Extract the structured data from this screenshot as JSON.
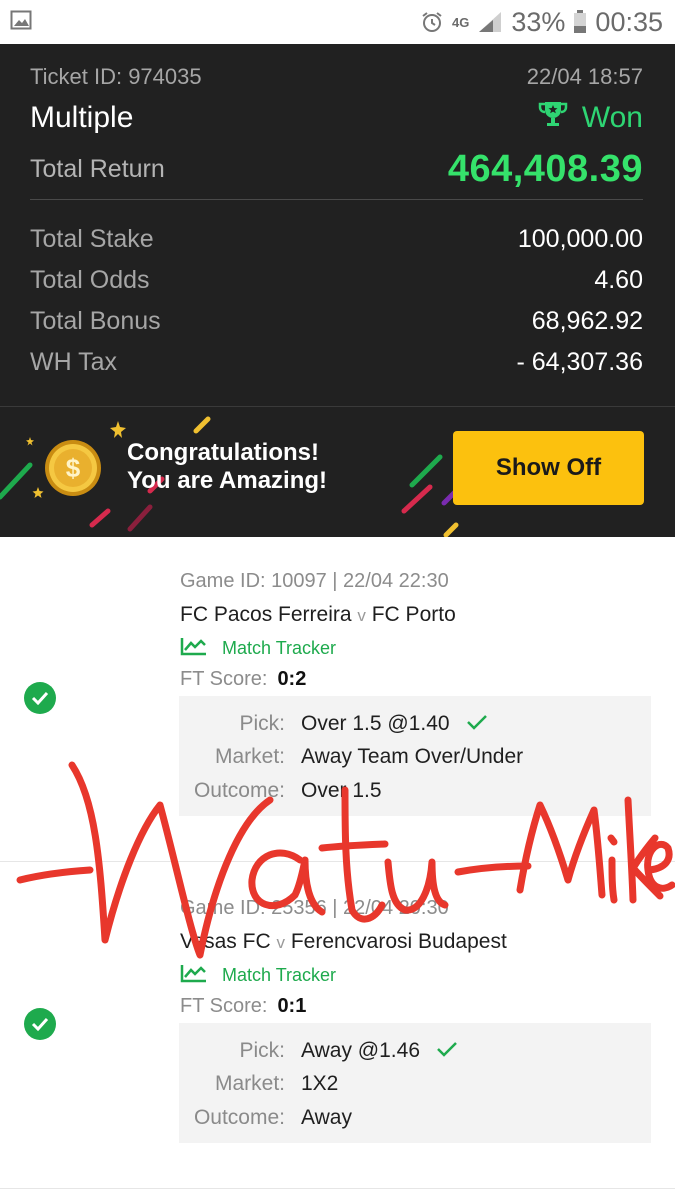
{
  "status_bar": {
    "battery": "33%",
    "time": "00:35",
    "network": "4G"
  },
  "ticket": {
    "id_label": "Ticket ID: 974035",
    "datetime": "22/04 18:57",
    "type": "Multiple",
    "status": "Won",
    "total_return_label": "Total Return",
    "total_return": "464,408.39",
    "stats": [
      {
        "label": "Total Stake",
        "value": "100,000.00"
      },
      {
        "label": "Total Odds",
        "value": "4.60"
      },
      {
        "label": "Total Bonus",
        "value": "68,962.92"
      },
      {
        "label": "WH Tax",
        "value": "- 64,307.36"
      }
    ]
  },
  "banner": {
    "line1": "Congratulations!",
    "line2": "You are Amazing!",
    "button": "Show Off"
  },
  "selections": [
    {
      "game": "Game ID: 10097 | 22/04 22:30",
      "home": "FC Pacos Ferreira",
      "vs": "v",
      "away": "FC Porto",
      "tracker": "Match Tracker",
      "ft_label": "FT Score:",
      "ft_score": "0:2",
      "pick_label": "Pick:",
      "pick": "Over 1.5 @1.40",
      "market_label": "Market:",
      "market": "Away Team Over/Under",
      "outcome_label": "Outcome:",
      "outcome": "Over 1.5"
    },
    {
      "game": "Game ID: 25356 | 22/04 20:30",
      "home": "Vasas FC",
      "vs": "v",
      "away": "Ferencvarosi Budapest",
      "tracker": "Match Tracker",
      "ft_label": "FT Score:",
      "ft_score": "0:1",
      "pick_label": "Pick:",
      "pick": "Away @1.46",
      "market_label": "Market:",
      "market": "1X2",
      "outcome_label": "Outcome:",
      "outcome": "Away"
    }
  ],
  "colors": {
    "dark_bg": "#212121",
    "accent_green": "#35e26b",
    "check_green": "#1eaa4d",
    "button_yellow": "#fcc10e",
    "watermark_red": "#e8372c"
  }
}
